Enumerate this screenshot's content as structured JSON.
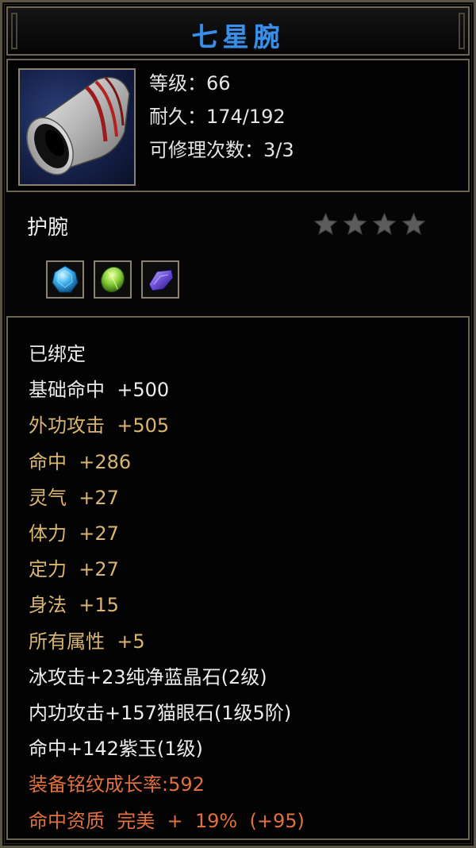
{
  "item": {
    "name": "七星腕",
    "name_color": "#3c8fe6",
    "icon": "bracer-icon",
    "stats": [
      {
        "label": "等级：66"
      },
      {
        "label": "耐久：174/192"
      },
      {
        "label": "可修理次数：3/3"
      }
    ],
    "type": "护腕",
    "stars": {
      "filled": 0,
      "total": 4
    },
    "gems": [
      {
        "name": "blue-crystal-gem-icon",
        "color": "#3fb6f0"
      },
      {
        "name": "green-cat-eye-gem-icon",
        "color": "#8ad23a"
      },
      {
        "name": "purple-jade-gem-icon",
        "color": "#6a4fd6"
      }
    ]
  },
  "attributes": [
    {
      "text": "已绑定",
      "color": "white"
    },
    {
      "text": "基础命中  +500",
      "color": "white"
    },
    {
      "text": "外功攻击  +505",
      "color": "gold"
    },
    {
      "text": "命中  +286",
      "color": "gold"
    },
    {
      "text": "灵气  +27",
      "color": "gold"
    },
    {
      "text": "体力  +27",
      "color": "gold"
    },
    {
      "text": "定力  +27",
      "color": "gold"
    },
    {
      "text": "身法  +15",
      "color": "gold"
    },
    {
      "text": "所有属性  +5",
      "color": "gold"
    },
    {
      "text": "冰攻击+23纯净蓝晶石(2级)",
      "color": "white"
    },
    {
      "text": "内功攻击+157猫眼石(1级5阶)",
      "color": "white"
    },
    {
      "text": "命中+142紫玉(1级)",
      "color": "white"
    },
    {
      "text": "装备铭纹成长率:592",
      "color": "orange"
    },
    {
      "text": "命中资质  完美  +  19%  (+95)",
      "color": "orange"
    }
  ]
}
